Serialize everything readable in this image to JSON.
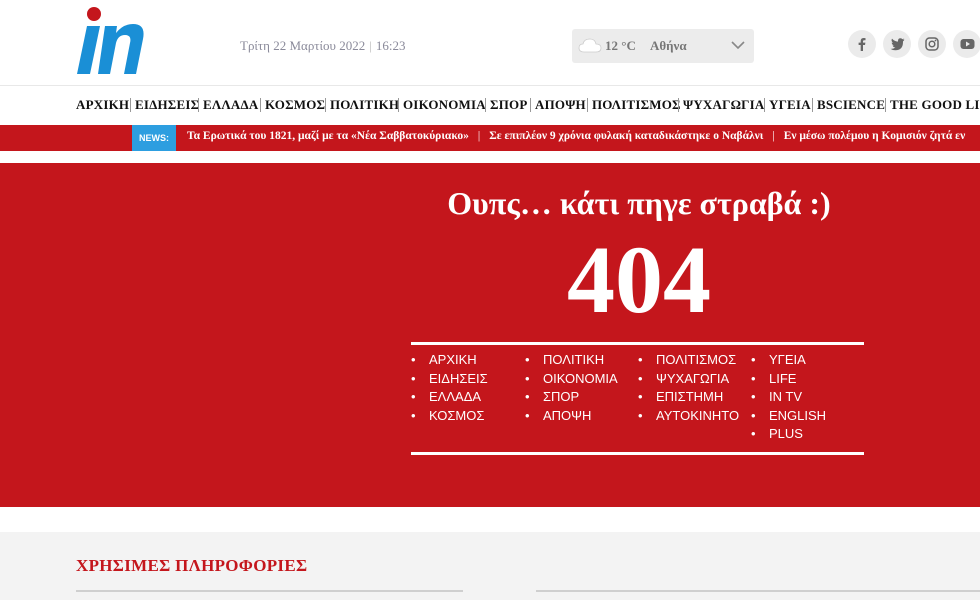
{
  "header": {
    "logo_text": "in",
    "date": "Τρίτη 22 Μαρτίου 2022",
    "time": "16:23",
    "weather": {
      "temp": "12 °C",
      "city": "Αθήνα",
      "icon": "cloud-icon"
    },
    "social": [
      "facebook-icon",
      "twitter-icon",
      "instagram-icon",
      "youtube-icon"
    ]
  },
  "nav": {
    "items": [
      "ΑΡΧΙΚΗ",
      "ΕΙΔΗΣΕΙΣ",
      "ΕΛΛΑΔΑ",
      "ΚΟΣΜΟΣ",
      "ΠΟΛΙΤΙΚΗ",
      "ΟΙΚΟΝΟΜΙΑ",
      "ΣΠΟΡ",
      "ΑΠΟΨΗ",
      "ΠΟΛΙΤΙΣΜΟΣ",
      "ΨΥΧΑΓΩΓΙΑ",
      "ΥΓΕΙΑ",
      "BSCIENCE",
      "THE GOOD LIFE"
    ]
  },
  "ticker": {
    "label": "NEWS:",
    "items": [
      "Τα Ερωτικά του 1821, μαζί με τα «Νέα Σαββατοκύριακο»",
      "Σε επιπλέον 9 χρόνια φυλακή καταδικάστηκε ο Ναβάλνι",
      "Εν μέσω πολέμου η Κομισιόν ζητά εν"
    ],
    "separator": "|"
  },
  "error": {
    "title": "Ουπς… κάτι πηγε στραβά :)",
    "code": "404",
    "columns": [
      [
        "ΑΡΧΙΚΗ",
        "ΕΙΔΗΣΕΙΣ",
        "ΕΛΛΑΔΑ",
        "ΚΟΣΜΟΣ"
      ],
      [
        "ΠΟΛΙΤΙΚΗ",
        "ΟΙΚΟΝΟΜΙΑ",
        "ΣΠΟΡ",
        "ΑΠΟΨΗ"
      ],
      [
        "ΠΟΛΙΤΙΣΜΟΣ",
        "ΨΥΧΑΓΩΓΙΑ",
        "ΕΠΙΣΤΗΜΗ",
        "ΑΥΤΟΚΙΝΗΤΟ"
      ],
      [
        "ΥΓΕΙΑ",
        "LIFE",
        "IN TV",
        "ENGLISH",
        "PLUS"
      ]
    ]
  },
  "footer": {
    "title": "ΧΡΗΣΙΜΕΣ ΠΛΗΡΟΦΟΡΙΕΣ"
  },
  "colors": {
    "brand_red": "#c4161c",
    "logo_blue": "#1a8fd6",
    "news_blue": "#2d9ee0"
  }
}
